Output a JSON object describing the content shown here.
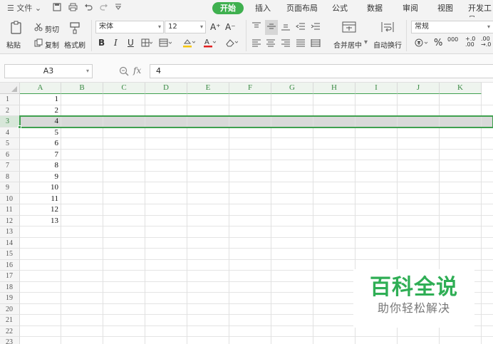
{
  "menubar": {
    "file_menu": "☰ 文件 ⌄",
    "tabs": [
      {
        "label": "开始",
        "active": true
      },
      {
        "label": "插入",
        "active": false
      },
      {
        "label": "页面布局",
        "active": false
      },
      {
        "label": "公式",
        "active": false
      },
      {
        "label": "数据",
        "active": false
      },
      {
        "label": "审阅",
        "active": false
      },
      {
        "label": "视图",
        "active": false
      },
      {
        "label": "开发工具",
        "active": false
      }
    ],
    "accent_color": "#3fb04f"
  },
  "ribbon": {
    "paste": "粘贴",
    "cut": "剪切",
    "copy": "复制",
    "format_painter": "格式刷",
    "font_name": "宋体",
    "font_size": "12",
    "grow_font": "A⁺",
    "shrink_font": "A⁻",
    "bold": "B",
    "italic": "I",
    "underline": "U",
    "merge_center": "合并居中",
    "wrap_text": "自动换行",
    "number_format": "常规",
    "percent": "%",
    "thousands": "000",
    "inc_decimal": "+.0 .00",
    "dec_decimal": ".00 →.0"
  },
  "formula_bar": {
    "name_box": "A3",
    "fx_label": "fx",
    "formula_value": "4"
  },
  "sheet": {
    "columns": [
      "A",
      "B",
      "C",
      "D",
      "E",
      "F",
      "G",
      "H",
      "I",
      "J",
      "K"
    ],
    "rows": [
      "1",
      "2",
      "3",
      "4",
      "5",
      "6",
      "7",
      "8",
      "9",
      "10",
      "11",
      "12",
      "13",
      "14",
      "15",
      "16",
      "17",
      "18",
      "19",
      "20",
      "21",
      "22",
      "23"
    ],
    "column_a_values": [
      "1",
      "2",
      "4",
      "5",
      "6",
      "7",
      "8",
      "9",
      "10",
      "11",
      "12",
      "13"
    ],
    "selected_row": "3",
    "selected_cell": "A3"
  },
  "watermark": {
    "title": "百科全说",
    "subtitle": "助你轻松解决"
  }
}
